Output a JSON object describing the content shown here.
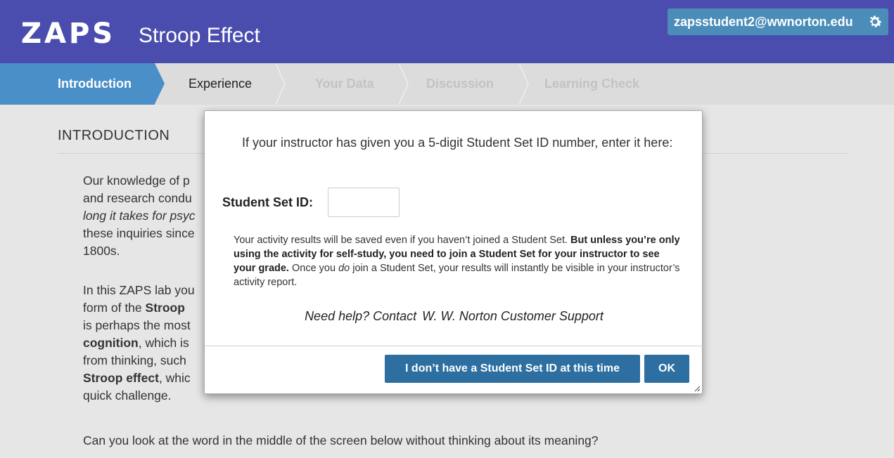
{
  "header": {
    "logo": "ZAPS",
    "title": "Stroop Effect",
    "user_email": "zapsstudent2@wwnorton.edu",
    "gear_icon": "gear-icon"
  },
  "tabs": [
    {
      "label": "Introduction",
      "state": "active"
    },
    {
      "label": "Experience",
      "state": "enabled"
    },
    {
      "label": "Your Data",
      "state": "disabled"
    },
    {
      "label": "Discussion",
      "state": "disabled"
    },
    {
      "label": "Learning Check",
      "state": "disabled"
    }
  ],
  "content": {
    "section_title": "INTRODUCTION",
    "p1_lines": [
      "Our knowledge of p",
      "and research condu",
      "long it takes for psyc",
      "these inquiries since",
      "1800s."
    ],
    "p2": {
      "l1": "In this ZAPS lab you",
      "l2a": "form of the ",
      "l2b": "Stroop",
      "l3": "is perhaps the most",
      "l4a": "cognition",
      "l4b": ", which is",
      "l5": "from thinking, such",
      "l6a": "Stroop effect",
      "l6b": ", whic",
      "l7": "quick challenge."
    },
    "p3": "Can you look at the word in the middle of the screen below without thinking about its meaning?"
  },
  "modal": {
    "lead": "If your instructor has given you a 5-digit Student Set ID number, enter it here:",
    "sid_label": "Student Set ID:",
    "sid_value": "",
    "notice_1": "Your activity results will be saved even if you haven’t joined a Student Set. ",
    "notice_bold": "But unless you’re only using the activity for self-study, you need to join a Student Set for your instructor to see your grade.",
    "notice_2": " Once you ",
    "notice_em": "do",
    "notice_3": " join a Student Set, your results will instantly be visible in your instructor’s activity report.",
    "help_text": "Need help? Contact",
    "help_link": "W. W. Norton Customer Support",
    "no_id_button": "I don’t have a Student Set ID at this time",
    "ok_button": "OK"
  },
  "colors": {
    "header_bg": "#4a4dad",
    "user_button": "#4b8db8",
    "active_tab": "#4a8fc8",
    "primary_button": "#2d6fa0",
    "page_bg": "#e6e6e6"
  }
}
